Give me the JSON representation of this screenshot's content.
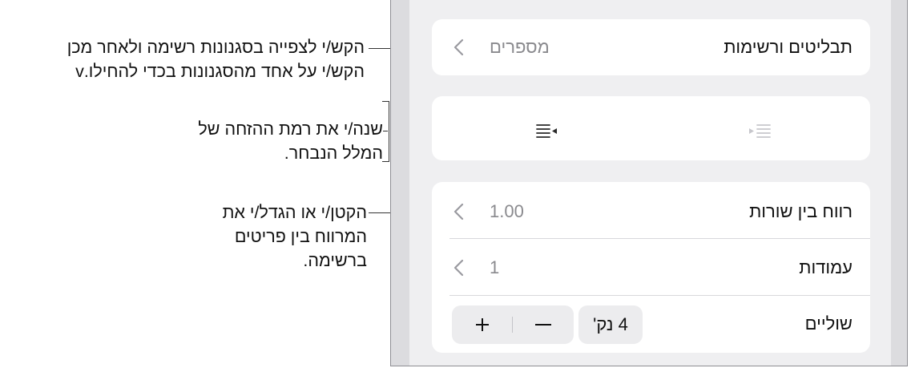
{
  "panel": {
    "bullets_row": {
      "label": "תבליטים ורשימות",
      "value": "מספרים"
    },
    "indent": {
      "decrease_icon": "outdent-icon",
      "increase_icon": "indent-icon"
    },
    "line_spacing": {
      "label": "רווח בין שורות",
      "value": "1.00"
    },
    "columns": {
      "label": "עמודות",
      "value": "1"
    },
    "margins": {
      "label": "שוליים",
      "value": "4 נק'",
      "minus": "−",
      "plus": "+"
    }
  },
  "callouts": {
    "bullets": {
      "line1": "הקש/י לצפייה בסגנונות רשימה ולאחר מכן",
      "line2": "הקש/י על אחד מהסגנונות בכדי להחילו.v"
    },
    "indent": {
      "line1": "שנה/י את רמת ההזחה של",
      "line2": "המלל הנבחר."
    },
    "spacing": {
      "line1": "הקטן/י או הגדל/י את",
      "line2": "המרווח בין פריטים",
      "line3": "ברשימה."
    }
  },
  "colors": {
    "panel_bg": "#efeff1",
    "card_bg": "#ffffff",
    "secondary_text": "#8a8a8e",
    "gutter": "#dcdcdf"
  }
}
